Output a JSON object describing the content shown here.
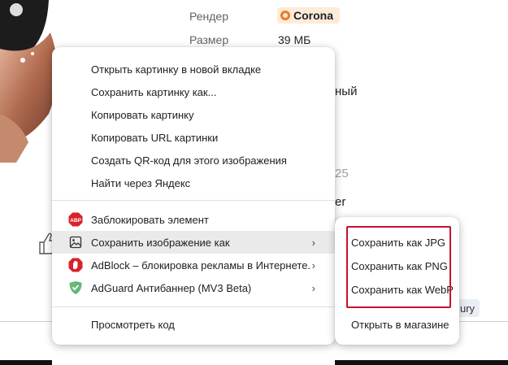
{
  "background": {
    "props": [
      {
        "label": "Рендер",
        "value": "Corona",
        "badge": true
      },
      {
        "label": "Размер",
        "value": "39 МБ"
      }
    ],
    "fragments": {
      "nyi": "ный",
      "num": "25",
      "er": "er",
      "ury": "ury"
    },
    "colors": {
      "badge_bg": "#fdebd9",
      "badge_icon": "#f07b1e"
    }
  },
  "menu": {
    "items": [
      {
        "label": "Открыть картинку в новой вкладке"
      },
      {
        "label": "Сохранить картинку как..."
      },
      {
        "label": "Копировать картинку"
      },
      {
        "label": "Копировать URL картинки"
      },
      {
        "label": "Создать QR-код для этого изображения"
      },
      {
        "label": "Найти через Яндекс"
      }
    ],
    "extensions": [
      {
        "label": "Заблокировать элемент",
        "icon": "abp-icon"
      },
      {
        "label": "Сохранить изображение как",
        "icon": "image-icon",
        "arrow": "›",
        "highlighted": true
      },
      {
        "label": "AdBlock – блокировка рекламы в Интернете.",
        "icon": "adblock-hand-icon",
        "arrow": "›"
      },
      {
        "label": "AdGuard Антибаннер (MV3 Beta)",
        "icon": "adguard-shield-icon",
        "arrow": "›"
      }
    ],
    "inspect": "Просмотреть код",
    "abp_text": "ABP"
  },
  "submenu": {
    "items": [
      {
        "label": "Сохранить как JPG"
      },
      {
        "label": "Сохранить как PNG"
      },
      {
        "label": "Сохранить как WebP"
      }
    ],
    "store": "Открыть в магазине",
    "highlight_color": "#c8102e"
  }
}
